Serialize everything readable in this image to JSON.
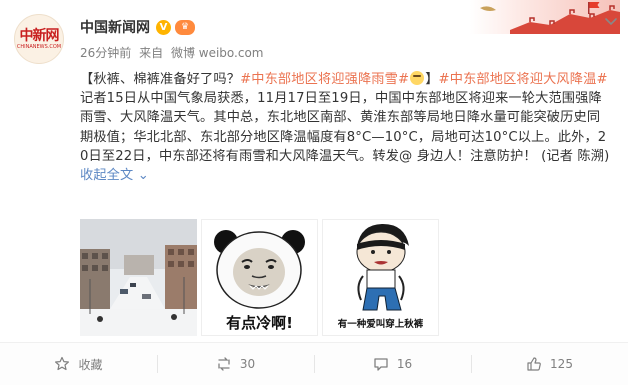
{
  "header": {
    "account_name": "中国新闻网",
    "verified_badge": "V",
    "vip_badge": "♛",
    "time_ago": "26分钟前",
    "source_prefix": "来自",
    "source_name": "微博 weibo.com",
    "avatar_text_cn": "中新网",
    "avatar_text_en": "CHINANEWS.COM"
  },
  "post": {
    "segment_1": "【秋裤、棉裤准备好了吗？",
    "hashtag_1": "#中东部地区将迎强降雨雪#",
    "segment_2": "】",
    "hashtag_2": "#中东部地区将迎大风降温#",
    "body": "记者15日从中国气象局获悉，11月17日至19日，中国中东部地区将迎来一轮大范围强降雨雪、大风降温天气。其中总，东北地区南部、黄淮东部等局地日降水量可能突破历史同期极值；华北北部、东北部分地区降温幅度有8°C—10°C，局地可达10°C以上。此外，20日至22日，中东部还将有雨雪和大风降温天气。转发@ 身边人！注意防护！ (记者 陈溯) ",
    "collapse_link": "收起全文",
    "collapse_chevron": "⌄"
  },
  "images": {
    "image_2_caption": "有点冷啊!",
    "image_3_caption": "有一种爱叫穿上秋裤"
  },
  "actions": {
    "favorite_label": "收藏",
    "repost_count": "30",
    "comment_count": "16",
    "like_count": "125"
  },
  "colors": {
    "link": "#eb7350",
    "text": "#333333",
    "muted": "#808080",
    "brand_red": "#c81f1f"
  }
}
